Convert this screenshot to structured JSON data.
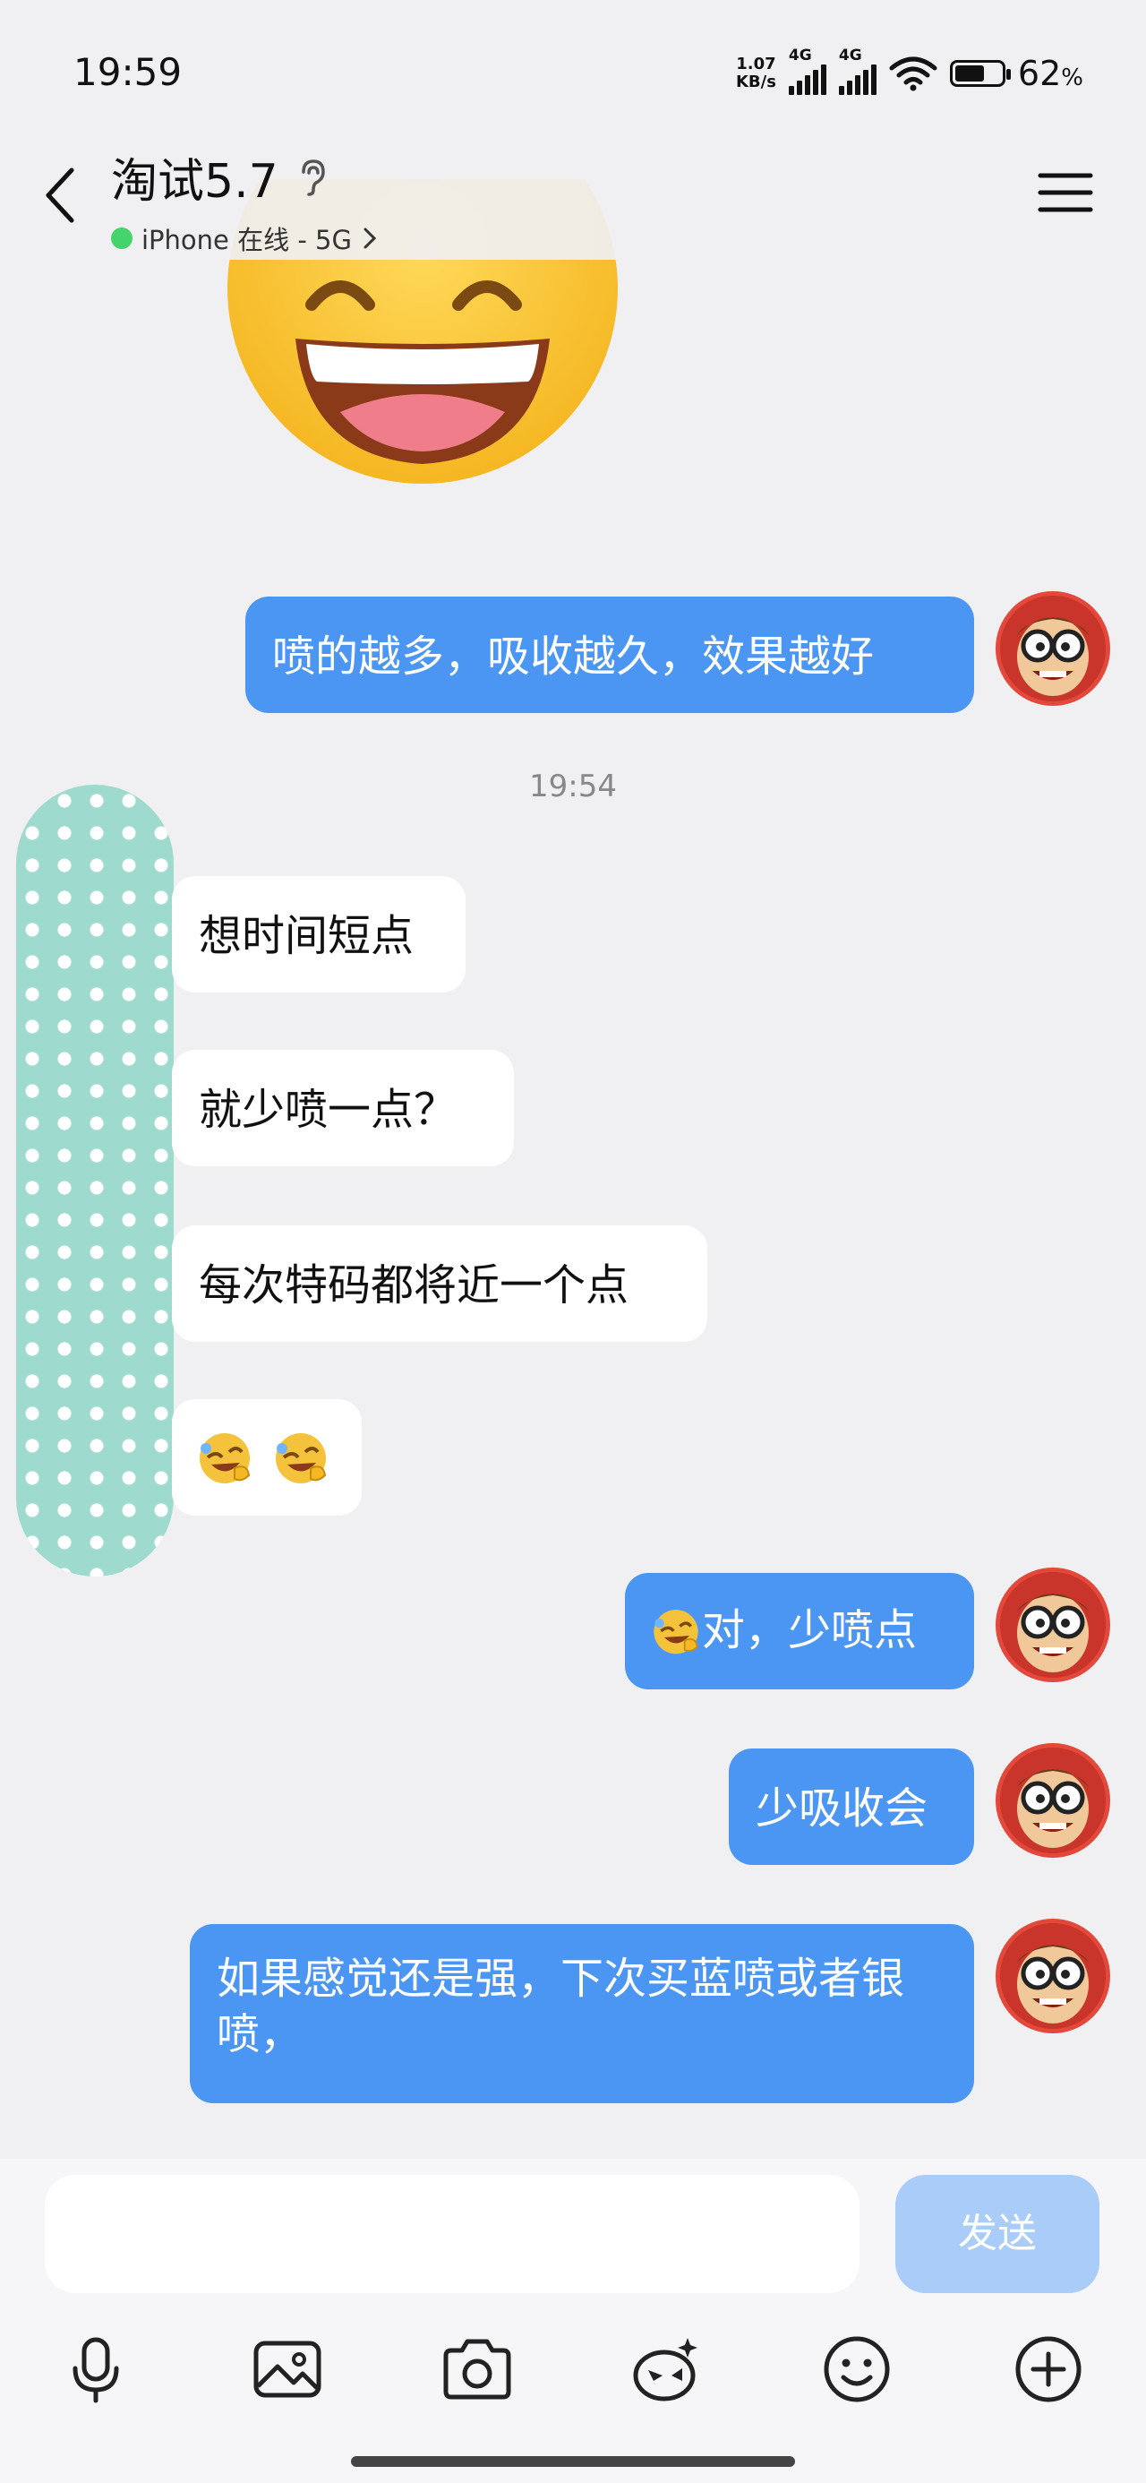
{
  "status_bar": {
    "time": "19:59",
    "net_speed_top": "1.07",
    "net_speed_bottom": "KB/s",
    "sig1_label": "4G",
    "sig2_label": "4G",
    "battery": "62",
    "battery_unit": "%"
  },
  "header": {
    "title": "淘试5.7",
    "status": "iPhone 在线 - 5G"
  },
  "messages": [
    {
      "side": "me",
      "text": "喷的越多，吸收越久，效果越好"
    },
    {
      "timestamp": "19:54"
    },
    {
      "side": "them",
      "text": "想时间短点"
    },
    {
      "side": "them",
      "text": "就少喷一点？"
    },
    {
      "side": "them",
      "text": "每次特码都将近一个点"
    },
    {
      "side": "them",
      "emoji": "laugh-cry-emoji x2"
    },
    {
      "side": "me",
      "text": "对，少喷点",
      "prefix_emoji": "laugh-cry-emoji"
    },
    {
      "side": "me",
      "text": "少吸收会"
    },
    {
      "side": "me",
      "text": "如果感觉还是强，下次买蓝喷或者银喷，"
    }
  ],
  "composer": {
    "placeholder": "",
    "send_label": "发送"
  },
  "toolbar": [
    "microphone-icon",
    "image-icon",
    "camera-icon",
    "sticker-icon",
    "emoji-icon",
    "plus-icon"
  ],
  "colors": {
    "my_bubble": "#4c96f3",
    "their_bubble": "#ffffff",
    "background": "#f0f0f3",
    "send_disabled": "#a9cdf8",
    "online_dot": "#45d36b"
  }
}
